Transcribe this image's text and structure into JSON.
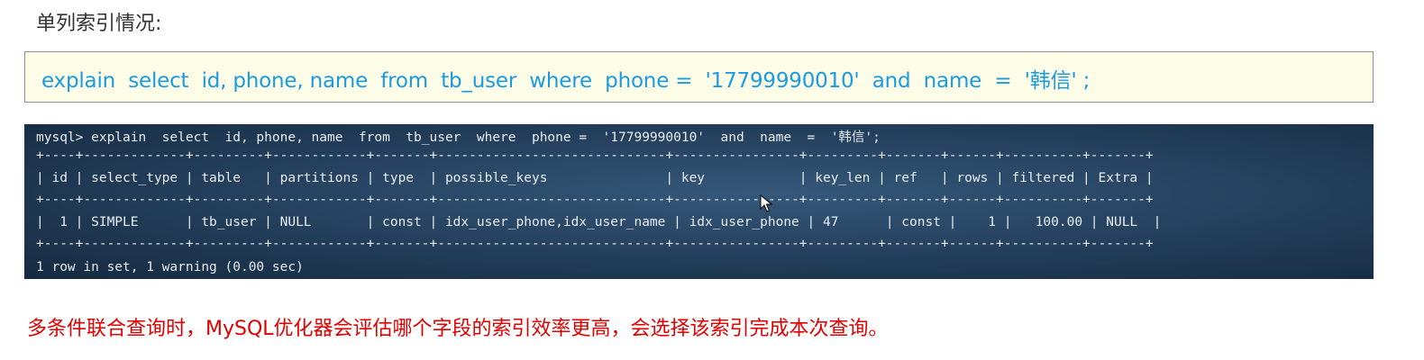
{
  "heading": "单列索引情况:",
  "sql_statement": "explain  select  id, phone, name  from  tb_user  where  phone =  '17799990010'  and  name  =  '韩信' ;",
  "terminal": {
    "command": "mysql> explain  select  id, phone, name  from  tb_user  where  phone =  '17799990010'  and  name  =  '韩信';",
    "border_line": "+----+-------------+---------+------------+-------+-----------------------------+----------------+---------+-------+------+----------+-------+",
    "header_line": "| id | select_type | table   | partitions | type  | possible_keys               | key            | key_len | ref   | rows | filtered | Extra |",
    "row_line": "|  1 | SIMPLE      | tb_user | NULL       | const | idx_user_phone,idx_user_name | idx_user_phone | 47      | const |    1 |   100.00 | NULL  |",
    "footer": "1 row in set, 1 warning (0.00 sec)",
    "columns": [
      "id",
      "select_type",
      "table",
      "partitions",
      "type",
      "possible_keys",
      "key",
      "key_len",
      "ref",
      "rows",
      "filtered",
      "Extra"
    ],
    "rows": [
      [
        "1",
        "SIMPLE",
        "tb_user",
        "NULL",
        "const",
        "idx_user_phone,idx_user_name",
        "idx_user_phone",
        "47",
        "const",
        "1",
        "100.00",
        "NULL"
      ]
    ]
  },
  "note": "多条件联合查询时，MySQL优化器会评估哪个字段的索引效率更高，会选择该索引完成本次查询。",
  "colors": {
    "sql_text": "#1a9be0",
    "sql_box_bg": "#fdfce6",
    "terminal_bg": "#233e5a",
    "note_text": "#e00000"
  },
  "icons": {
    "cursor": "mouse-pointer-icon"
  }
}
